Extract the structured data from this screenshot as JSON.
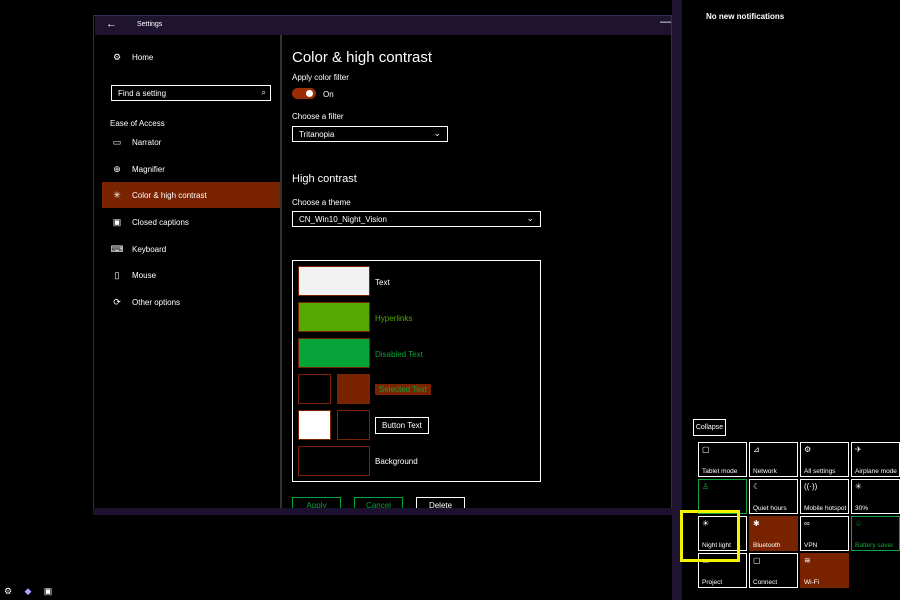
{
  "window": {
    "title": "Settings",
    "back": "←",
    "minimize": "—"
  },
  "sidebar": {
    "home": "Home",
    "search_placeholder": "Find a setting",
    "section": "Ease of Access",
    "items": [
      {
        "label": "Narrator",
        "icon": "narrator-icon"
      },
      {
        "label": "Magnifier",
        "icon": "magnifier-icon"
      },
      {
        "label": "Color & high contrast",
        "icon": "brightness-icon"
      },
      {
        "label": "Closed captions",
        "icon": "captions-icon"
      },
      {
        "label": "Keyboard",
        "icon": "keyboard-icon"
      },
      {
        "label": "Mouse",
        "icon": "mouse-icon"
      },
      {
        "label": "Other options",
        "icon": "other-options-icon"
      }
    ]
  },
  "main": {
    "title": "Color & high contrast",
    "apply_filter_label": "Apply color filter",
    "toggle_state": "On",
    "choose_filter_label": "Choose a filter",
    "filter_value": "Tritanopia",
    "high_contrast_heading": "High contrast",
    "choose_theme_label": "Choose a theme",
    "theme_value": "CN_Win10_Night_Vision",
    "preview": {
      "text": "Text",
      "hyperlinks": "Hyperlinks",
      "disabled_text": "Disabled Text",
      "selected_text": "Selected Text",
      "button_text": "Button Text",
      "background": "Background"
    },
    "buttons": {
      "apply": "Apply",
      "cancel": "Cancel",
      "delete": "Delete"
    },
    "colors": {
      "accent": "#7a2300",
      "hyperlink": "#55a800",
      "disabled": "#07a43a",
      "text_sw": "#f2f2f2"
    }
  },
  "action_center": {
    "no_notifications": "No new notifications",
    "collapse": "Collapse",
    "tiles": [
      {
        "label": "Tablet mode",
        "icon": "tablet-icon",
        "state": "off"
      },
      {
        "label": "Network",
        "icon": "network-icon",
        "state": "off"
      },
      {
        "label": "All settings",
        "icon": "gear-icon",
        "state": "off"
      },
      {
        "label": "Airplane mode",
        "icon": "airplane-icon",
        "state": "off"
      },
      {
        "label": "",
        "icon": "location-icon",
        "state": "green"
      },
      {
        "label": "Quiet hours",
        "icon": "moon-icon",
        "state": "off"
      },
      {
        "label": "Mobile hotspot",
        "icon": "hotspot-icon",
        "state": "off"
      },
      {
        "label": "30%",
        "icon": "brightness-icon",
        "state": "off"
      },
      {
        "label": "Night light",
        "icon": "night-light-icon",
        "state": "off"
      },
      {
        "label": "Bluetooth",
        "icon": "bluetooth-icon",
        "state": "on"
      },
      {
        "label": "VPN",
        "icon": "vpn-icon",
        "state": "off"
      },
      {
        "label": "Battery saver",
        "icon": "leaf-icon",
        "state": "green"
      },
      {
        "label": "Project",
        "icon": "project-icon",
        "state": "off"
      },
      {
        "label": "Connect",
        "icon": "connect-icon",
        "state": "off"
      },
      {
        "label": "Wi-Fi",
        "icon": "wifi-icon",
        "state": "on"
      }
    ]
  }
}
